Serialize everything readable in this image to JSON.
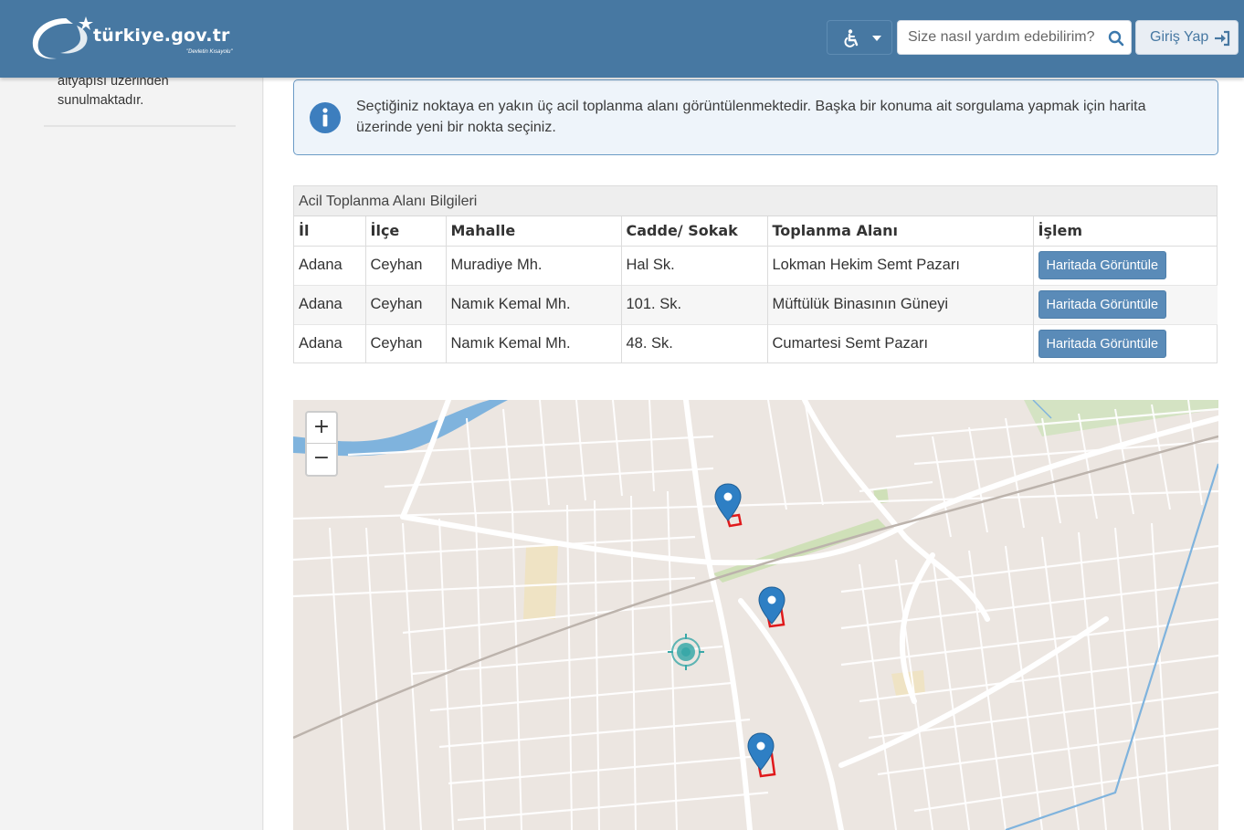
{
  "header": {
    "logo_text": "türkiye.gov.tr",
    "logo_subtitle": "\"Devletin Kısayolu\"",
    "accessibility_icon": "wheelchair-icon",
    "search_placeholder": "Size nasıl yardım edebilirim?",
    "search_icon": "search-icon",
    "login_label": "Giriş Yap",
    "login_icon": "sign-in-icon"
  },
  "sidebar": {
    "text": "İçişleri Bakanlığı Afet ve Acil Durum Yönetimi Başkanlığı işbirliği ile e-Devlet Kapısı altyapısı üzerinden sunulmaktadır."
  },
  "alert": {
    "icon": "info-icon",
    "text": "Seçtiğiniz noktaya en yakın üç acil toplanma alanı görüntülenmektedir. Başka bir konuma ait sorgulama yapmak için harita üzerinde yeni bir nokta seçiniz."
  },
  "table": {
    "title": "Acil Toplanma Alanı Bilgileri",
    "headers": [
      "İl",
      "İlçe",
      "Mahalle",
      "Cadde/ Sokak",
      "Toplanma Alanı",
      "İşlem"
    ],
    "rows": [
      {
        "il": "Adana",
        "ilce": "Ceyhan",
        "mahalle": "Muradiye Mh.",
        "sokak": "Hal Sk.",
        "alan": "Lokman Hekim Semt Pazarı",
        "islem": "Haritada Görüntüle"
      },
      {
        "il": "Adana",
        "ilce": "Ceyhan",
        "mahalle": "Namık Kemal Mh.",
        "sokak": "101. Sk.",
        "alan": "Müftülük Binasının Güneyi",
        "islem": "Haritada Görüntüle"
      },
      {
        "il": "Adana",
        "ilce": "Ceyhan",
        "mahalle": "Namık Kemal Mh.",
        "sokak": "48. Sk.",
        "alan": "Cumartesi Semt Pazarı",
        "islem": "Haritada Görüntüle"
      }
    ]
  },
  "map": {
    "zoom_in": "+",
    "zoom_out": "−",
    "river_color": "#7fb3dd",
    "road_color": "#ffffff",
    "marker_color": "#2e7fc4",
    "area_outline_color": "#e0191b",
    "selected_point_color": "#3aa8a8"
  }
}
